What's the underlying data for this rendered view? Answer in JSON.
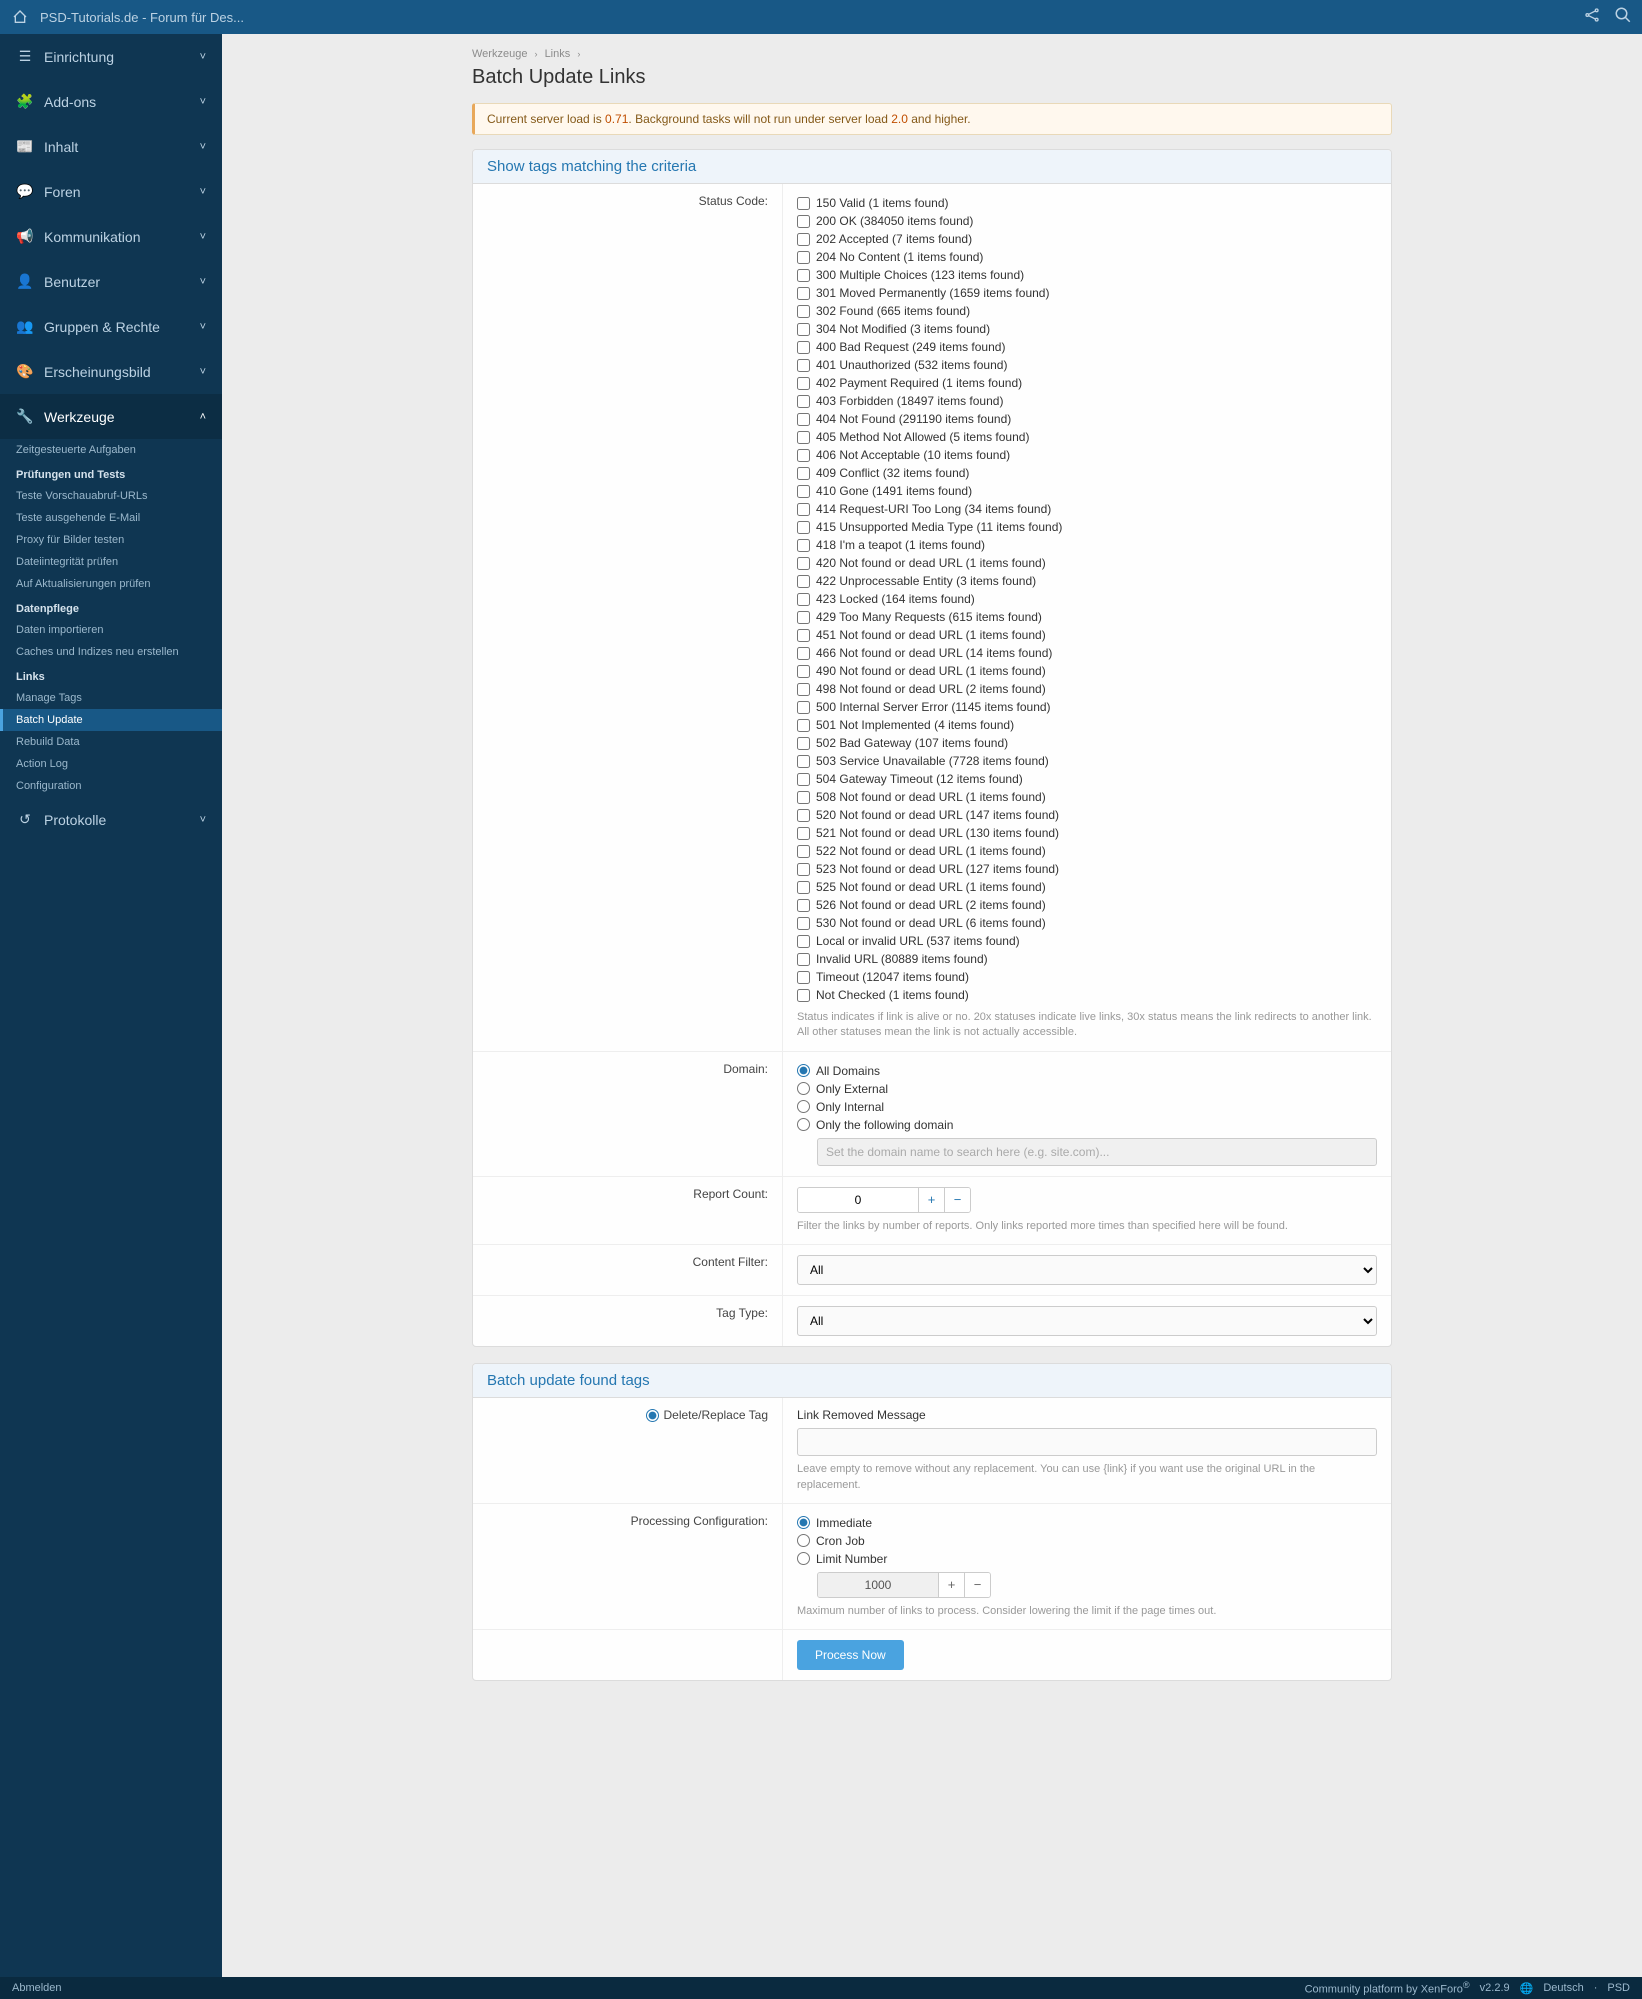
{
  "topbar": {
    "title": "PSD-Tutorials.de - Forum für Des..."
  },
  "sidebar": {
    "items": [
      {
        "icon": "☰",
        "label": "Einrichtung"
      },
      {
        "icon": "🧩",
        "label": "Add-ons"
      },
      {
        "icon": "📰",
        "label": "Inhalt"
      },
      {
        "icon": "💬",
        "label": "Foren"
      },
      {
        "icon": "📢",
        "label": "Kommunikation"
      },
      {
        "icon": "👤",
        "label": "Benutzer"
      },
      {
        "icon": "👥",
        "label": "Gruppen & Rechte"
      },
      {
        "icon": "🎨",
        "label": "Erscheinungsbild"
      },
      {
        "icon": "🔧",
        "label": "Werkzeuge"
      },
      {
        "icon": "↺",
        "label": "Protokolle"
      }
    ],
    "werkzeuge": {
      "top": [
        {
          "label": "Zeitgesteuerte Aufgaben"
        }
      ],
      "groups": [
        {
          "header": "Prüfungen und Tests",
          "items": [
            {
              "label": "Teste Vorschauabruf-URLs"
            },
            {
              "label": "Teste ausgehende E-Mail"
            },
            {
              "label": "Proxy für Bilder testen"
            },
            {
              "label": "Dateiintegrität prüfen"
            },
            {
              "label": "Auf Aktualisierungen prüfen"
            }
          ]
        },
        {
          "header": "Datenpflege",
          "items": [
            {
              "label": "Daten importieren"
            },
            {
              "label": "Caches und Indizes neu erstellen"
            }
          ]
        },
        {
          "header": "Links",
          "items": [
            {
              "label": "Manage Tags"
            },
            {
              "label": "Batch Update",
              "active": true
            },
            {
              "label": "Rebuild Data"
            },
            {
              "label": "Action Log"
            },
            {
              "label": "Configuration"
            }
          ]
        }
      ]
    }
  },
  "breadcrumb": {
    "a": "Werkzeuge",
    "b": "Links"
  },
  "page": {
    "title": "Batch Update Links"
  },
  "alert": {
    "text_pre": "Current server load is ",
    "load": "0.71",
    "text_mid": ". Background tasks will not run under server load ",
    "limit": "2.0",
    "text_post": " and higher."
  },
  "section1": {
    "title": "Show tags matching the criteria",
    "status_label": "Status Code:",
    "statuses": [
      "150 Valid (1 items found)",
      "200 OK (384050 items found)",
      "202 Accepted (7 items found)",
      "204 No Content (1 items found)",
      "300 Multiple Choices (123 items found)",
      "301 Moved Permanently (1659 items found)",
      "302 Found (665 items found)",
      "304 Not Modified (3 items found)",
      "400 Bad Request (249 items found)",
      "401 Unauthorized (532 items found)",
      "402 Payment Required (1 items found)",
      "403 Forbidden (18497 items found)",
      "404 Not Found (291190 items found)",
      "405 Method Not Allowed (5 items found)",
      "406 Not Acceptable (10 items found)",
      "409 Conflict (32 items found)",
      "410 Gone (1491 items found)",
      "414 Request-URI Too Long (34 items found)",
      "415 Unsupported Media Type (11 items found)",
      "418 I'm a teapot (1 items found)",
      "420 Not found or dead URL (1 items found)",
      "422 Unprocessable Entity (3 items found)",
      "423 Locked (164 items found)",
      "429 Too Many Requests (615 items found)",
      "451 Not found or dead URL (1 items found)",
      "466 Not found or dead URL (14 items found)",
      "490 Not found or dead URL (1 items found)",
      "498 Not found or dead URL (2 items found)",
      "500 Internal Server Error (1145 items found)",
      "501 Not Implemented (4 items found)",
      "502 Bad Gateway (107 items found)",
      "503 Service Unavailable (7728 items found)",
      "504 Gateway Timeout (12 items found)",
      "508 Not found or dead URL (1 items found)",
      "520 Not found or dead URL (147 items found)",
      "521 Not found or dead URL (130 items found)",
      "522 Not found or dead URL (1 items found)",
      "523 Not found or dead URL (127 items found)",
      "525 Not found or dead URL (1 items found)",
      "526 Not found or dead URL (2 items found)",
      "530 Not found or dead URL (6 items found)",
      "Local or invalid URL (537 items found)",
      "Invalid URL (80889 items found)",
      "Timeout (12047 items found)",
      "Not Checked (1 items found)"
    ],
    "status_hint": "Status indicates if link is alive or no. 20x statuses indicate live links, 30x status means the link redirects to another link. All other statuses mean the link is not actually accessible.",
    "domain_label": "Domain:",
    "domain_options": [
      "All Domains",
      "Only External",
      "Only Internal",
      "Only the following domain"
    ],
    "domain_placeholder": "Set the domain name to search here (e.g. site.com)...",
    "report_label": "Report Count:",
    "report_value": "0",
    "report_hint": "Filter the links by number of reports. Only links reported more times than specified here will be found.",
    "content_filter_label": "Content Filter:",
    "content_filter_value": "All",
    "tag_type_label": "Tag Type:",
    "tag_type_value": "All"
  },
  "section2": {
    "title": "Batch update found tags",
    "delete_label": "Delete/Replace Tag",
    "delete_value": "Link Removed Message",
    "delete_hint": "Leave empty to remove without any replacement. You can use {link} if you want use the original URL in the replacement.",
    "proc_label": "Processing Configuration:",
    "proc_options": [
      "Immediate",
      "Cron Job",
      "Limit Number"
    ],
    "limit_value": "1000",
    "limit_hint": "Maximum number of links to process. Consider lowering the limit if the page times out.",
    "submit": "Process Now"
  },
  "footer": {
    "logout": "Abmelden",
    "platform": "Community platform by XenForo",
    "version": "v2.2.9",
    "lang": "Deutsch",
    "brand": "PSD"
  }
}
